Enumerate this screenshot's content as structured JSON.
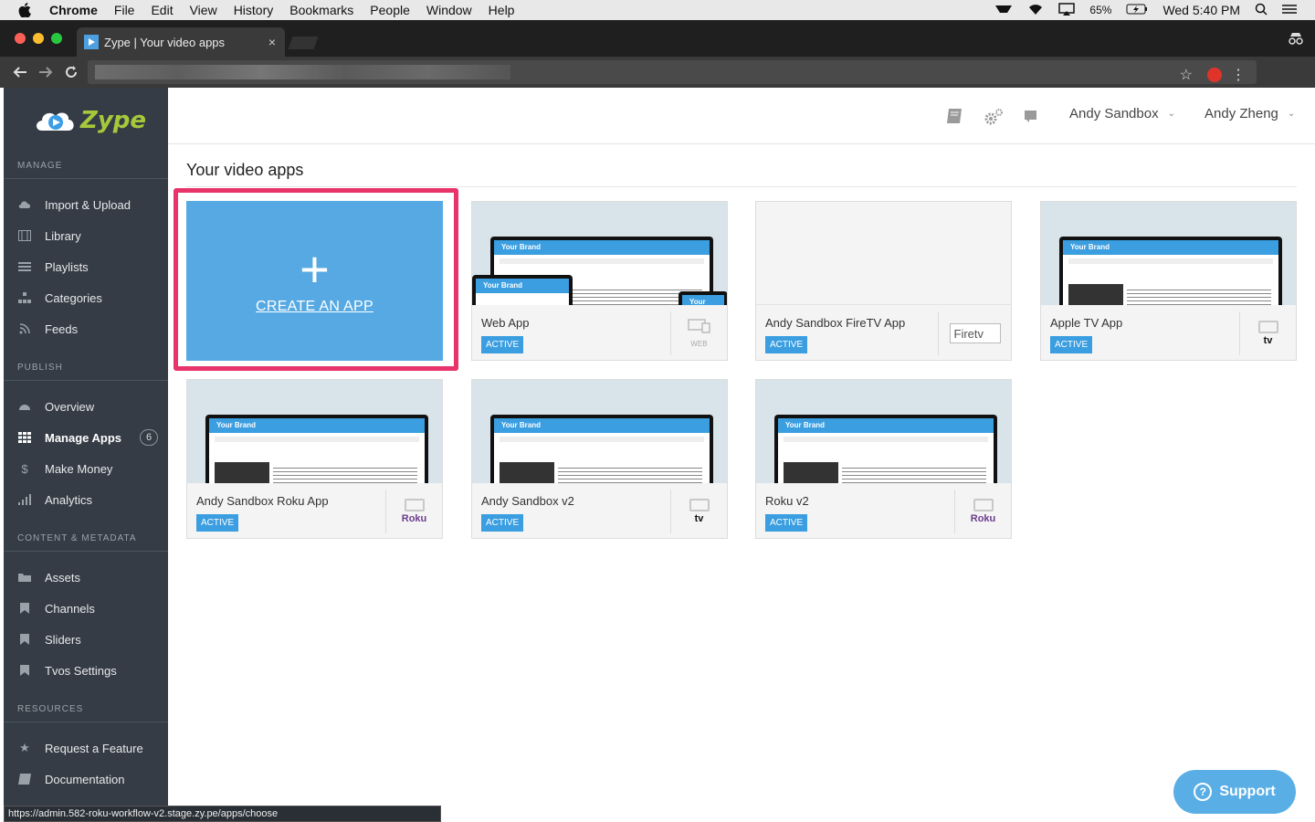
{
  "menubar": {
    "items": [
      "Chrome",
      "File",
      "Edit",
      "View",
      "History",
      "Bookmarks",
      "People",
      "Window",
      "Help"
    ],
    "battery": "65%",
    "clock": "Wed 5:40 PM"
  },
  "browser": {
    "tab_title": "Zype | Your video apps",
    "tab_close": "×",
    "status_url": "https://admin.582-roku-workflow-v2.stage.zy.pe/apps/choose"
  },
  "sidebar": {
    "logo": "Zype",
    "sections": {
      "manage": "MANAGE",
      "publish": "PUBLISH",
      "content": "CONTENT & METADATA",
      "resources": "RESOURCES"
    },
    "manage": [
      {
        "label": "Import & Upload",
        "icon": "cloud-upload-icon"
      },
      {
        "label": "Library",
        "icon": "film-icon"
      },
      {
        "label": "Playlists",
        "icon": "list-icon"
      },
      {
        "label": "Categories",
        "icon": "sitemap-icon"
      },
      {
        "label": "Feeds",
        "icon": "rss-icon"
      }
    ],
    "publish": [
      {
        "label": "Overview",
        "icon": "dashboard-icon"
      },
      {
        "label": "Manage Apps",
        "icon": "grid-icon",
        "badge": "6"
      },
      {
        "label": "Make Money",
        "icon": "dollar-icon"
      },
      {
        "label": "Analytics",
        "icon": "bar-chart-icon"
      }
    ],
    "content": [
      {
        "label": "Assets",
        "icon": "folder-icon"
      },
      {
        "label": "Channels",
        "icon": "bookmark-icon"
      },
      {
        "label": "Sliders",
        "icon": "bookmark-icon"
      },
      {
        "label": "Tvos Settings",
        "icon": "bookmark-icon"
      }
    ],
    "resources": [
      {
        "label": "Request a Feature",
        "icon": "star-icon"
      },
      {
        "label": "Documentation",
        "icon": "book-icon"
      }
    ]
  },
  "header": {
    "org_dropdown": "Andy Sandbox",
    "user_dropdown": "Andy Zheng"
  },
  "main": {
    "title": "Your video apps",
    "create_label": "CREATE AN APP",
    "create_plus": "+",
    "brand_text": "Your Brand",
    "apps": [
      {
        "name": "Web App",
        "status": "ACTIVE",
        "platform": "web",
        "platform_label": "WEB"
      },
      {
        "name": "Andy Sandbox FireTV App",
        "status": "ACTIVE",
        "platform": "firetv",
        "platform_label": "Firetv"
      },
      {
        "name": "Apple TV App",
        "status": "ACTIVE",
        "platform": "appletv",
        "platform_label": "tv"
      },
      {
        "name": "Andy Sandbox Roku App",
        "status": "ACTIVE",
        "platform": "roku",
        "platform_label": "Roku"
      },
      {
        "name": "Andy Sandbox v2",
        "status": "ACTIVE",
        "platform": "appletv",
        "platform_label": "tv"
      },
      {
        "name": "Roku v2",
        "status": "ACTIVE",
        "platform": "roku",
        "platform_label": "Roku"
      }
    ]
  },
  "support": {
    "label": "Support",
    "icon_glyph": "?"
  },
  "colors": {
    "accent": "#56a9e2",
    "highlight": "#e8336b",
    "sidebar": "#353c45",
    "badge": "#3b9ee0",
    "logo": "#a6c93b"
  }
}
